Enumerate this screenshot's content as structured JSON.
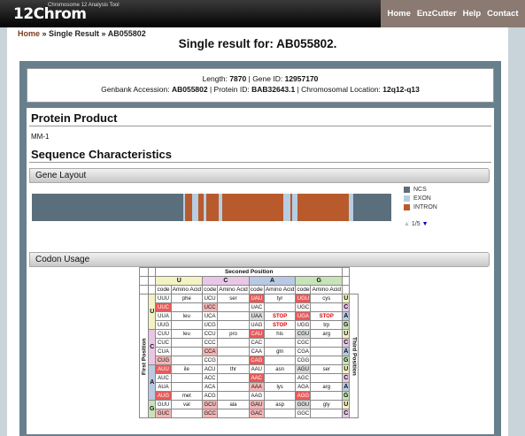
{
  "app": {
    "logo": "12Chrom",
    "tagline": "Chromosome 12 Analysis Tool"
  },
  "nav": [
    "Home",
    "EnzCutter",
    "Help",
    "Contact"
  ],
  "breadcrumb": {
    "home": "Home",
    "sep1": " » ",
    "single": "Single Result",
    "sep2": " » ",
    "current": "AB055802"
  },
  "page_title": "Single result for: AB055802.",
  "summary": {
    "length_label": "Length:",
    "length": "7870",
    "gene_id_label": "Gene ID:",
    "gene_id": "12957170",
    "genbank_label": "Genbank Accession:",
    "genbank": "AB055802",
    "protein_id_label": "Protein ID:",
    "protein_id": "BAB32643.1",
    "location_label": "Chromosomal Location:",
    "location": "12q12-q13"
  },
  "protein_product": {
    "heading": "Protein Product",
    "name": "MM-1"
  },
  "sequence_characteristics": {
    "heading": "Sequence Characteristics"
  },
  "gene_layout": {
    "label": "Gene Layout",
    "legend": [
      {
        "name": "NCS",
        "color": "#5b6e7c"
      },
      {
        "name": "EXON",
        "color": "#b7cde2"
      },
      {
        "name": "INTRON",
        "color": "#b85a2c"
      }
    ],
    "pager": "1/5",
    "segments": [
      {
        "type": "NCS",
        "start": 0,
        "end": 0.422
      },
      {
        "type": "EXON",
        "start": 0.422,
        "end": 0.427
      },
      {
        "type": "INTRON",
        "start": 0.427,
        "end": 0.446
      },
      {
        "type": "EXON",
        "start": 0.446,
        "end": 0.463
      },
      {
        "type": "INTRON",
        "start": 0.463,
        "end": 0.478
      },
      {
        "type": "EXON",
        "start": 0.478,
        "end": 0.485
      },
      {
        "type": "INTRON",
        "start": 0.485,
        "end": 0.52
      },
      {
        "type": "EXON",
        "start": 0.52,
        "end": 0.53
      },
      {
        "type": "INTRON",
        "start": 0.53,
        "end": 0.7
      },
      {
        "type": "EXON",
        "start": 0.7,
        "end": 0.72
      },
      {
        "type": "INTRON",
        "start": 0.72,
        "end": 0.725
      },
      {
        "type": "EXON",
        "start": 0.725,
        "end": 0.738
      },
      {
        "type": "INTRON",
        "start": 0.738,
        "end": 0.882
      },
      {
        "type": "EXON",
        "start": 0.882,
        "end": 0.893
      },
      {
        "type": "NCS",
        "start": 0.893,
        "end": 1
      }
    ]
  },
  "codon_usage": {
    "label": "Codon Usage",
    "second_position": "Seconed Position",
    "first_position": "First Position",
    "third_position": "Third Position",
    "col_code": "code",
    "col_aa": "Amino Acid",
    "bases": [
      "U",
      "C",
      "A",
      "G"
    ],
    "rows": [
      {
        "first": "U",
        "third": "U",
        "cells": [
          [
            "UUU",
            "phe"
          ],
          [
            "UCU",
            "ser"
          ],
          [
            "UAU",
            "tyr"
          ],
          [
            "UGU",
            "cys"
          ]
        ]
      },
      {
        "first": "U",
        "third": "C",
        "cells": [
          [
            "UUC",
            ""
          ],
          [
            "UCC",
            ""
          ],
          [
            "UAC",
            ""
          ],
          [
            "UGC",
            ""
          ]
        ]
      },
      {
        "first": "U",
        "third": "A",
        "cells": [
          [
            "UUA",
            "leu"
          ],
          [
            "UCA",
            ""
          ],
          [
            "UAA",
            "STOP"
          ],
          [
            "UGA",
            "STOP"
          ]
        ]
      },
      {
        "first": "U",
        "third": "G",
        "cells": [
          [
            "UUG",
            ""
          ],
          [
            "UCG",
            ""
          ],
          [
            "UAG",
            "STOP"
          ],
          [
            "UGG",
            "trp"
          ]
        ]
      },
      {
        "first": "C",
        "third": "U",
        "cells": [
          [
            "CUU",
            "leu"
          ],
          [
            "CCU",
            "pro"
          ],
          [
            "CAU",
            "his"
          ],
          [
            "CGU",
            "arg"
          ]
        ]
      },
      {
        "first": "C",
        "third": "C",
        "cells": [
          [
            "CUC",
            ""
          ],
          [
            "CCC",
            ""
          ],
          [
            "CAC",
            ""
          ],
          [
            "CGC",
            ""
          ]
        ]
      },
      {
        "first": "C",
        "third": "A",
        "cells": [
          [
            "CUA",
            ""
          ],
          [
            "CCA",
            ""
          ],
          [
            "CAA",
            "gln"
          ],
          [
            "CGA",
            ""
          ]
        ]
      },
      {
        "first": "C",
        "third": "G",
        "cells": [
          [
            "CUG",
            ""
          ],
          [
            "CCG",
            ""
          ],
          [
            "CAG",
            ""
          ],
          [
            "CGG",
            ""
          ]
        ]
      },
      {
        "first": "A",
        "third": "U",
        "cells": [
          [
            "AUU",
            "ile"
          ],
          [
            "ACU",
            "thr"
          ],
          [
            "AAU",
            "asn"
          ],
          [
            "AGU",
            "ser"
          ]
        ]
      },
      {
        "first": "A",
        "third": "C",
        "cells": [
          [
            "AUC",
            ""
          ],
          [
            "ACC",
            ""
          ],
          [
            "AAC",
            ""
          ],
          [
            "AGC",
            ""
          ]
        ]
      },
      {
        "first": "A",
        "third": "A",
        "cells": [
          [
            "AUA",
            ""
          ],
          [
            "ACA",
            ""
          ],
          [
            "AAA",
            "lys"
          ],
          [
            "AGA",
            "arg"
          ]
        ]
      },
      {
        "first": "A",
        "third": "G",
        "cells": [
          [
            "AUG",
            "met"
          ],
          [
            "ACG",
            ""
          ],
          [
            "AAG",
            ""
          ],
          [
            "AGG",
            ""
          ]
        ]
      },
      {
        "first": "G",
        "third": "U",
        "cells": [
          [
            "GUU",
            "val"
          ],
          [
            "GCU",
            "ala"
          ],
          [
            "GAU",
            "asp"
          ],
          [
            "GGU",
            "gly"
          ]
        ]
      },
      {
        "first": "G",
        "third": "C",
        "cells": [
          [
            "GUC",
            ""
          ],
          [
            "GCC",
            ""
          ],
          [
            "GAC",
            ""
          ],
          [
            "GGC",
            ""
          ]
        ]
      }
    ],
    "highlight": {
      "UUC": "red",
      "UCC": "pink",
      "UAU": "red",
      "UAA": "gray",
      "UGA": "red",
      "UGU": "red",
      "CUG": "pink",
      "CCA": "pink",
      "CAU": "red",
      "CAG": "red",
      "CGU": "gray",
      "AUU": "red",
      "AUG": "red",
      "AAC": "red",
      "AAA": "pink",
      "AGG": "red",
      "AGU": "gray",
      "GUC": "pink",
      "GCU": "pink",
      "GCC": "pink",
      "GAU": "pink",
      "GAC": "pink",
      "GGU": "gray"
    }
  }
}
